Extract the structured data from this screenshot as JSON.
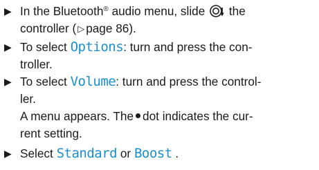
{
  "steps": [
    {
      "bullet": "▶",
      "line1_a": "In the Bluetooth",
      "line1_sup": "®",
      "line1_b": "audio menu, slide",
      "line1_c": "the",
      "line2_a": "controller (",
      "line2_ref_icon": "▷",
      "line2_b": "page 86)."
    },
    {
      "bullet": "▶",
      "line1_a": "To select",
      "line1_mono": "Options",
      "line1_b": ": turn and press the con-",
      "line2": "troller."
    },
    {
      "bullet": "▶",
      "line1_a": "To select",
      "line1_mono": "Volume",
      "line1_b": ": turn and press the control-",
      "line2": "ler.",
      "line3": "A menu appears. The",
      "line3_dot": "•",
      "line3_b": "dot indicates the cur-",
      "line4": "rent setting."
    },
    {
      "bullet": "▶",
      "line1_a": "Select",
      "option_a": "Standard",
      "line1_or": "or",
      "option_b": "Boost",
      "line1_end": "."
    }
  ],
  "icons": {
    "controller": "controller-slide-down-icon",
    "page_ref": "page-reference-triangle-icon",
    "dot": "dot-icon",
    "bullet": "step-bullet-triangle-icon"
  },
  "colors": {
    "text": "#1a1a1a",
    "menu_item": "#1a8fd0"
  }
}
